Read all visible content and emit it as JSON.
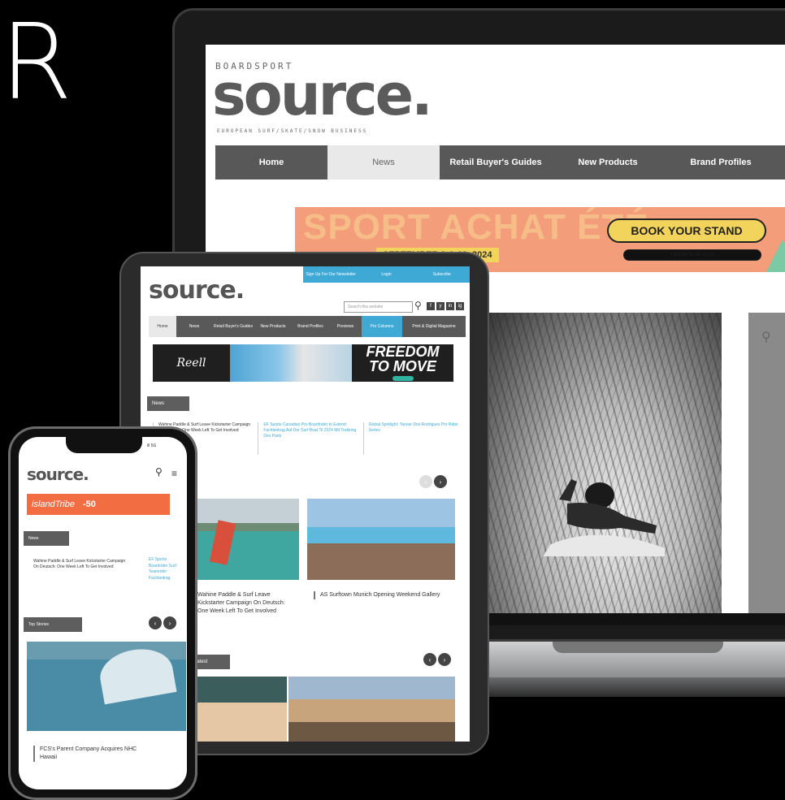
{
  "hero_letter": "R",
  "laptop": {
    "brand_top": "BOARDSPORT",
    "logo": "source.",
    "tagline": "EUROPEAN SURF/SKATE/SNOW BUSINESS",
    "nav": [
      {
        "label": "Home",
        "active": false
      },
      {
        "label": "News",
        "active": true
      },
      {
        "label": "Retail Buyer's Guides",
        "active": false
      },
      {
        "label": "New Products",
        "active": false
      },
      {
        "label": "Brand Profiles",
        "active": false
      }
    ],
    "banner": {
      "title": "SPORT ACHAT ÉTÉ",
      "dates": "SEPTEMBER 9 & 10, 2024",
      "cta": "BOOK YOUR STAND",
      "phone": "+33(0)4 38 38 23 50"
    },
    "side_icon": "search-icon"
  },
  "tablet": {
    "topbar": [
      "Sign Up For Our Newsletter",
      "Login",
      "Subscribe"
    ],
    "logo": "source.",
    "search_placeholder": "Search this website",
    "social": [
      "f",
      "y",
      "in",
      "ig"
    ],
    "nav": [
      {
        "label": "Home",
        "style": "active"
      },
      {
        "label": "News",
        "style": ""
      },
      {
        "label": "Retail Buyer's Guides",
        "style": ""
      },
      {
        "label": "New Products",
        "style": ""
      },
      {
        "label": "Brand Profiles",
        "style": ""
      },
      {
        "label": "Previews",
        "style": ""
      },
      {
        "label": "Pro Columns",
        "style": "blue"
      },
      {
        "label": "Print & Digital Magazine",
        "style": ""
      }
    ],
    "ad_left": "Reell",
    "ad_right_line1": "FREEDOM",
    "ad_right_line2": "TO MOVE",
    "news_label": "News",
    "ticker": [
      "Wahine Paddle & Surf Leave Kickstarter Campaign On Deutsch: One Week Left To Get Involved",
      "EF Sports Canadian Pro Boardrider to Extend Fachbeitrag Auf Der Surf Boat Til 2024 Mit Trekking Des Parts",
      "Global Spotlight: Tanner Dos Rodrigues Pro Rider Series"
    ],
    "story1": "Wahine Paddle & Surf Leave Kickstarter Campaign On Deutsch: One Week Left To Get Involved",
    "story2": "AS Surftown Munich Opening Weekend Gallery",
    "latest_label": "Latest"
  },
  "phone": {
    "status": "ill 5G",
    "logo": "source.",
    "ad_a": "islandTribe",
    "ad_b": "-50",
    "news_label": "News",
    "ticker": "Wahine Paddle & Surf Leave Kickstarter Campaign On Deutsch: One Week Left To Get Involved",
    "ticker2": "EF Sports Boardrider Surf Teamrider Fachbeitrag",
    "top_label": "Top Stories",
    "story": "FCS's Parent Company Acquires NHC Hawaii"
  }
}
